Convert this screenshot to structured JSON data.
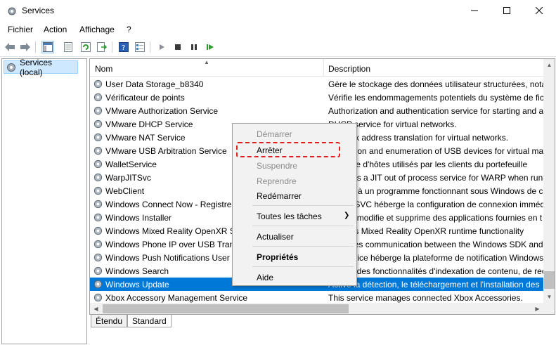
{
  "window": {
    "title": "Services"
  },
  "menu": [
    "Fichier",
    "Action",
    "Affichage",
    "?"
  ],
  "tree": {
    "item": "Services (local)"
  },
  "table": {
    "col_name": "Nom",
    "col_desc": "Description",
    "rows": [
      {
        "name": "User Data Storage_b8340",
        "desc": "Gère le stockage des données utilisateur structurées, notan"
      },
      {
        "name": "Vérificateur de points",
        "desc": "Vérifie les endommagements potentiels du système de fic"
      },
      {
        "name": "VMware Authorization Service",
        "desc": "Authorization and authentication service for starting and a"
      },
      {
        "name": "VMware DHCP Service",
        "desc": "DHCP service for virtual networks."
      },
      {
        "name": "VMware NAT Service",
        "desc": "Network address translation for virtual networks."
      },
      {
        "name": "VMware USB Arbitration Service",
        "desc": "Arbitration and enumeration of USB devices for virtual ma"
      },
      {
        "name": "WalletService",
        "desc": "Héberge d'hôtes utilisés par les clients du portefeuille"
      },
      {
        "name": "WarpJITSvc",
        "desc": "Provides a JIT out of process service for WARP when runni"
      },
      {
        "name": "WebClient",
        "desc": "Permet à un programme fonctionnant sous Windows de c"
      },
      {
        "name": "Windows Connect Now - Registre",
        "desc": "WCNCSVC héberge la configuration de connexion imméd"
      },
      {
        "name": "Windows Installer",
        "desc": "Ajoute, modifie et supprime des applications fournies en t"
      },
      {
        "name": "Windows Mixed Reality OpenXR Service",
        "desc": "Enables Mixed Reality OpenXR runtime functionality"
      },
      {
        "name": "Windows Phone IP over USB Transport",
        "desc": "Manages communication between the Windows SDK and a"
      },
      {
        "name": "Windows Push Notifications User Service",
        "desc": "Ce service héberge la plateforme de notification Windows"
      },
      {
        "name": "Windows Search",
        "desc": "Fournit des fonctionnalités d'indexation de contenu, de rec"
      },
      {
        "name": "Windows Update",
        "desc": "Active la détection, le téléchargement et l'installation des"
      },
      {
        "name": "Xbox Accessory Management Service",
        "desc": "This service manages connected Xbox Accessories."
      }
    ],
    "selected_row": "Windows Update"
  },
  "tabs": [
    "Étendu",
    "Standard"
  ],
  "context_menu": {
    "items": [
      {
        "label": "Démarrer",
        "state": "disabled"
      },
      {
        "label": "Arrêter",
        "state": "enabled",
        "highlighted": true
      },
      {
        "label": "Suspendre",
        "state": "disabled"
      },
      {
        "label": "Reprendre",
        "state": "disabled"
      },
      {
        "label": "Redémarrer",
        "state": "enabled"
      },
      {
        "label": "Toutes les tâches",
        "state": "enabled",
        "submenu": true
      },
      {
        "label": "Actualiser",
        "state": "enabled"
      },
      {
        "label": "Propriétés",
        "state": "enabled",
        "bold": true
      },
      {
        "label": "Aide",
        "state": "enabled"
      }
    ]
  },
  "colors": {
    "selection": "#0078d7",
    "highlight_dash": "#e02020",
    "play_green": "#2e9b2e"
  }
}
